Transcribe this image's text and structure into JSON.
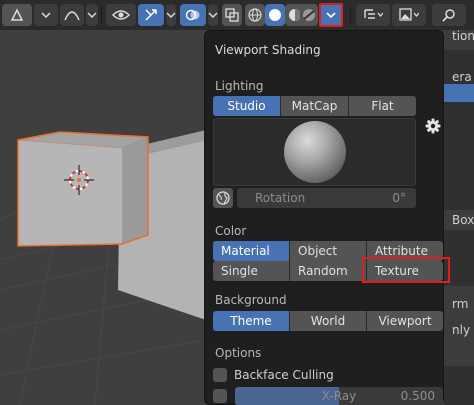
{
  "popover": {
    "title": "Viewport Shading",
    "lighting": {
      "label": "Lighting",
      "options": [
        {
          "label": "Studio",
          "active": true
        },
        {
          "label": "MatCap",
          "active": false
        },
        {
          "label": "Flat",
          "active": false
        }
      ],
      "rotation_label": "Rotation",
      "rotation_value": "0°"
    },
    "color": {
      "label": "Color",
      "options_row1": [
        {
          "label": "Material",
          "active": true
        },
        {
          "label": "Object",
          "active": false
        },
        {
          "label": "Attribute",
          "active": false
        }
      ],
      "options_row2": [
        {
          "label": "Single",
          "active": false
        },
        {
          "label": "Random",
          "active": false
        },
        {
          "label": "Texture",
          "active": false,
          "highlighted": true
        }
      ]
    },
    "background": {
      "label": "Background",
      "options": [
        {
          "label": "Theme",
          "active": true
        },
        {
          "label": "World",
          "active": false
        },
        {
          "label": "Viewport",
          "active": false
        }
      ]
    },
    "options": {
      "label": "Options",
      "backface_culling_label": "Backface Culling",
      "backface_culling_checked": false,
      "xray_label": "X-Ray",
      "xray_value": "0.500",
      "xray_fraction": 0.5,
      "xray_checked": false
    }
  },
  "header_icons": [
    "object-mode-icon",
    "dropdown-chevron-icon",
    "pivot-icon",
    "proportional-falloff-icon",
    "visibility-eye-icon",
    "gizmo-icon",
    "overlay-icon",
    "xray-toggle-icon",
    "wireframe-shading-icon",
    "solid-shading-icon",
    "material-preview-icon",
    "rendered-shading-icon",
    "shading-popover-chevron-icon"
  ],
  "right_panel_clipped": [
    "tion",
    "era",
    "Box",
    "rm",
    "nly"
  ],
  "colors": {
    "accent_blue": "#4772b3",
    "highlight_red": "#e01e1e",
    "selection_orange": "#e8702a"
  }
}
